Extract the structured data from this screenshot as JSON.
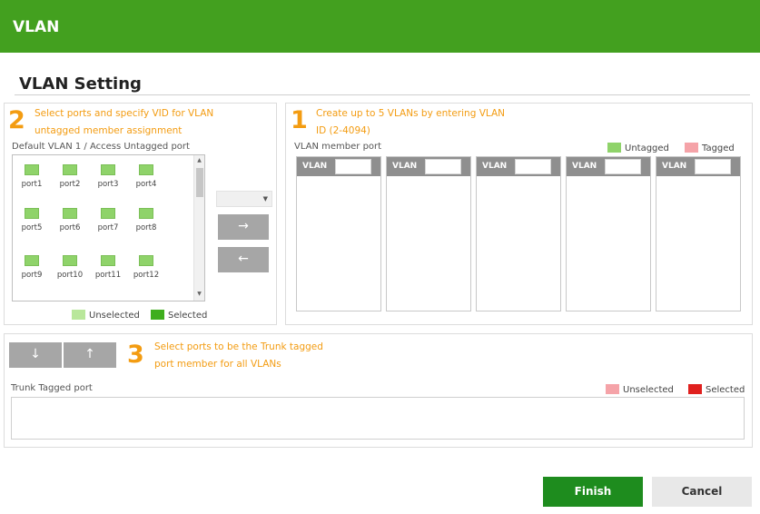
{
  "header": {
    "title": "VLAN"
  },
  "section": {
    "title": "VLAN Setting"
  },
  "step2": {
    "number": "2",
    "line1": "Select ports and specify VID for VLAN",
    "line2": "untagged member assignment",
    "box_label": "Default VLAN 1 / Access Untagged port",
    "ports": [
      "port1",
      "port2",
      "port3",
      "port4",
      "port5",
      "port6",
      "port7",
      "port8",
      "port9",
      "port10",
      "port11",
      "port12"
    ],
    "legend": {
      "unselected": "Unselected",
      "selected": "Selected"
    }
  },
  "step1": {
    "number": "1",
    "line1": "Create up to 5 VLANs by entering VLAN",
    "line2": "ID (2-4094)",
    "member_label": "VLAN member port",
    "legend": {
      "untagged": "Untagged",
      "tagged": "Tagged"
    },
    "vlan_columns": [
      {
        "label": "VLAN",
        "vid": ""
      },
      {
        "label": "VLAN",
        "vid": ""
      },
      {
        "label": "VLAN",
        "vid": ""
      },
      {
        "label": "VLAN",
        "vid": ""
      },
      {
        "label": "VLAN",
        "vid": ""
      }
    ]
  },
  "step3": {
    "number": "3",
    "line1": "Select ports to be the Trunk tagged",
    "line2": "port member for all VLANs",
    "trunk_label": "Trunk Tagged port",
    "legend": {
      "unselected": "Unselected",
      "selected": "Selected"
    }
  },
  "controls": {
    "vid_select_value": "",
    "move_right_icon": "arrow-right-icon",
    "move_left_icon": "arrow-left-icon",
    "move_down_icon": "arrow-down-icon",
    "move_up_icon": "arrow-up-icon"
  },
  "buttons": {
    "finish": "Finish",
    "cancel": "Cancel"
  },
  "colors": {
    "header_bg": "#43a01f",
    "accent_orange": "#f39c12",
    "port_unselected": "#b9e79b",
    "port_selected": "#3fae1d",
    "tag_untagged": "#8fd36a",
    "tag_tagged": "#f5a3a8",
    "trunk_unselected": "#f5a3a8",
    "trunk_selected": "#e0201e",
    "finish_bg": "#1e8c1e",
    "cancel_bg": "#e8e8e8"
  }
}
